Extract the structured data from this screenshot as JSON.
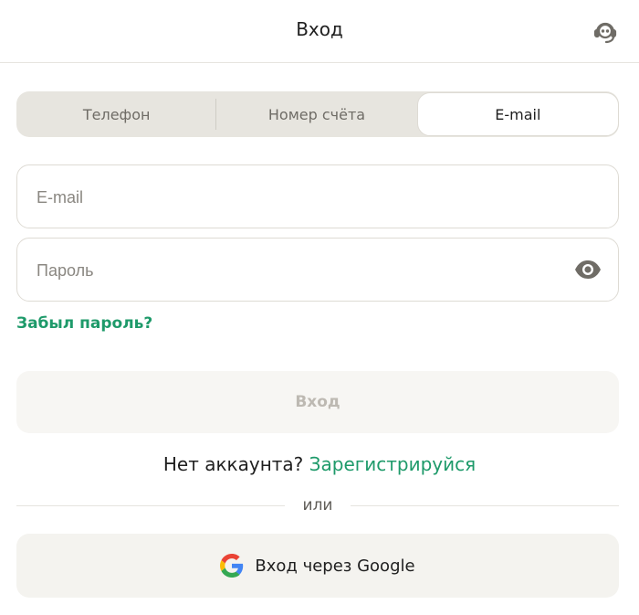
{
  "header": {
    "title": "Вход",
    "support_icon": "support-headset-icon"
  },
  "tabs": [
    {
      "label": "Телефон",
      "active": false
    },
    {
      "label": "Номер счёта",
      "active": false
    },
    {
      "label": "E-mail",
      "active": true
    }
  ],
  "form": {
    "email": {
      "placeholder": "E-mail",
      "value": ""
    },
    "password": {
      "placeholder": "Пароль",
      "value": "",
      "toggle_icon": "eye-icon"
    },
    "forgot_label": "Забыл пароль?",
    "submit_label": "Вход",
    "submit_enabled": false
  },
  "register": {
    "prompt": "Нет аккаунта?",
    "link_label": "Зарегистрируйся"
  },
  "divider_text": "или",
  "google": {
    "label": "Вход через Google",
    "icon": "google-icon"
  },
  "colors": {
    "accent": "#1e9a6a",
    "tabs_bg": "#e7e5df",
    "disabled_text": "#bdb9b2"
  }
}
